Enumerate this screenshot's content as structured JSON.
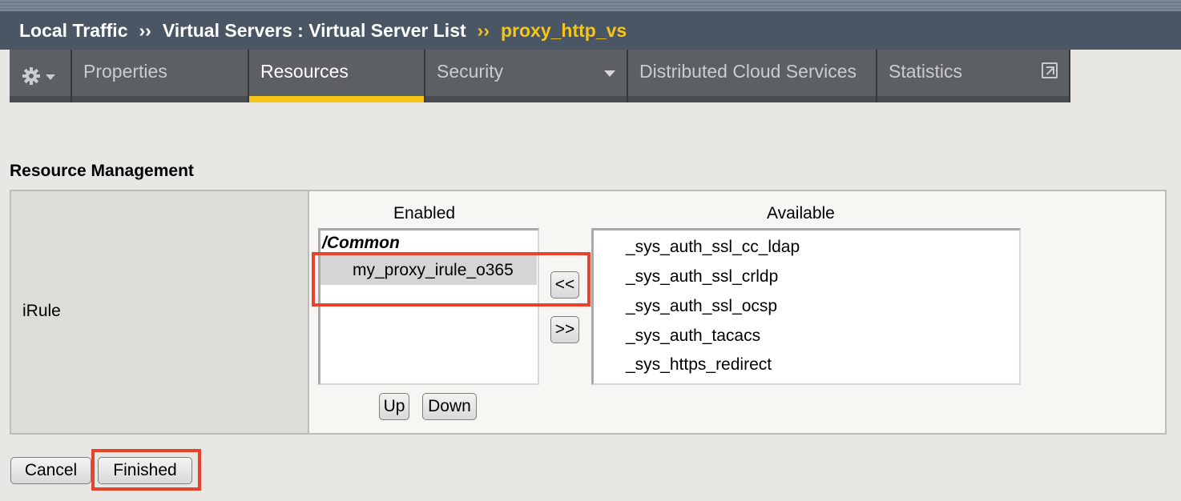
{
  "breadcrumb": {
    "part1": "Local Traffic",
    "sep1": "››",
    "part2": "Virtual Servers : Virtual Server List",
    "sep2": "››",
    "current": "proxy_http_vs"
  },
  "tabs": {
    "properties": "Properties",
    "resources": "Resources",
    "security": "Security",
    "distributed": "Distributed Cloud Services",
    "statistics": "Statistics"
  },
  "section": {
    "title": "Resource Management"
  },
  "irule": {
    "label": "iRule",
    "enabled_header": "Enabled",
    "available_header": "Available",
    "enabled_group": "/Common",
    "enabled_items": [
      "my_proxy_irule_o365"
    ],
    "available_items": [
      "_sys_auth_ssl_cc_ldap",
      "_sys_auth_ssl_crldp",
      "_sys_auth_ssl_ocsp",
      "_sys_auth_tacacs",
      "_sys_https_redirect"
    ],
    "move_left": "<<",
    "move_right": ">>",
    "up": "Up",
    "down": "Down"
  },
  "actions": {
    "cancel": "Cancel",
    "finished": "Finished"
  },
  "colors": {
    "accent": "#f5c518",
    "highlight": "#e8432a",
    "header_bg": "#4b5665"
  }
}
